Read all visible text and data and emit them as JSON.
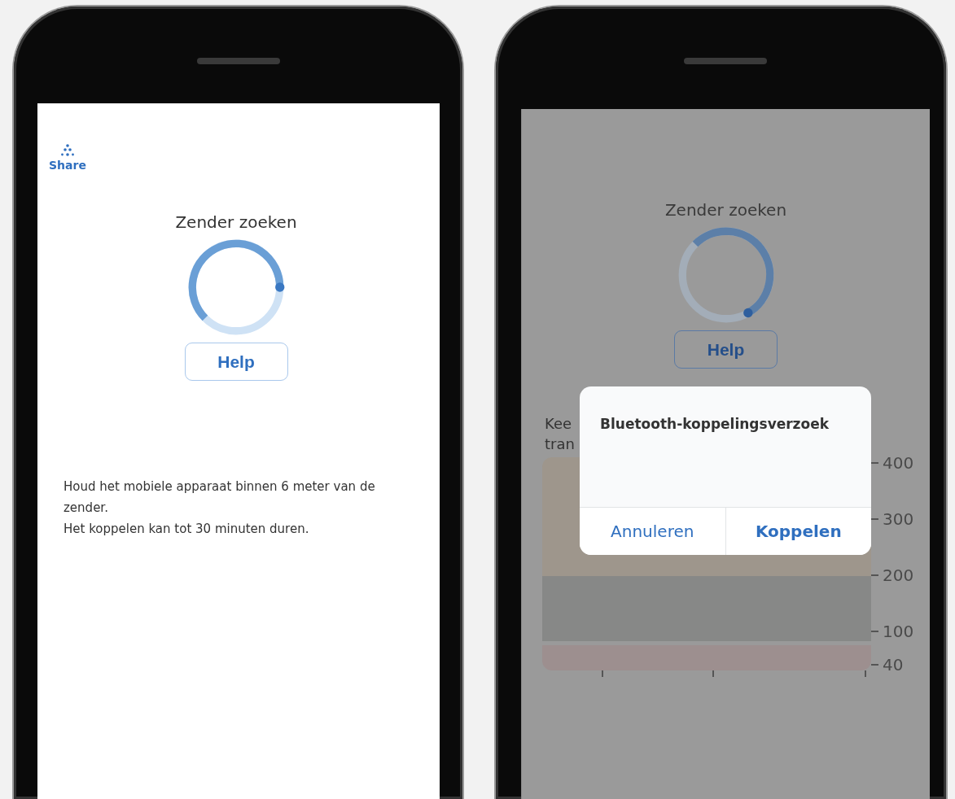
{
  "phones": [
    {
      "kind": "main",
      "share_label": "Share",
      "title": "Zender zoeken",
      "help_button": "Help",
      "instructions": [
        "Houd het mobiele apparaat binnen 6 meter van de zender.",
        "Het koppelen kan tot 30 minuten duren."
      ]
    },
    {
      "kind": "dimmed",
      "title": "Zender zoeken",
      "help_button": "Help",
      "partial_text": [
        "Kee",
        "tran"
      ],
      "chart_axis": [
        "400",
        "300",
        "200",
        "100",
        "40"
      ],
      "dialog": {
        "title": "Bluetooth-koppelingsverzoek",
        "buttons": [
          {
            "label": "Annuleren",
            "kind": "cancel"
          },
          {
            "label": "Koppelen",
            "kind": "default"
          }
        ]
      }
    }
  ]
}
